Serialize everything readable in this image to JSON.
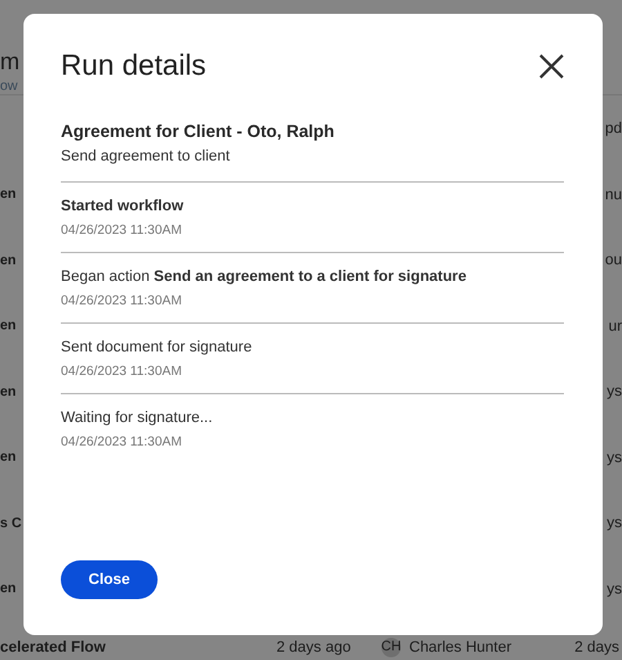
{
  "background": {
    "title": "m",
    "tab": "ow",
    "column_header": "pd",
    "rows": [
      {
        "name": "en",
        "updated": "nu"
      },
      {
        "name": "en",
        "updated": "ou"
      },
      {
        "name": "en",
        "updated": "ur"
      },
      {
        "name": "en",
        "updated": "ys"
      },
      {
        "name": "en",
        "updated": "ys"
      },
      {
        "name": "s C",
        "updated": "ys"
      },
      {
        "name": "en",
        "updated": "ys"
      }
    ],
    "last_row": {
      "name": "celerated Flow",
      "created": "2 days ago",
      "owner_initials": "CH",
      "owner": "Charles Hunter",
      "updated": "2 days"
    }
  },
  "dialog": {
    "title": "Run details",
    "agreement": "Agreement for Client - Oto, Ralph",
    "subtitle": "Send agreement to client",
    "events": [
      {
        "text": "Started workflow",
        "bold": true,
        "time": "04/26/2023 11:30AM"
      },
      {
        "text": "Began action **Send an agreement to a client for signature**",
        "bold": false,
        "time": "04/26/2023 11:30AM"
      },
      {
        "text": "Sent document for signature",
        "bold": false,
        "time": "04/26/2023 11:30AM"
      },
      {
        "text": "Waiting for signature...",
        "bold": false,
        "time": "04/26/2023 11:30AM"
      }
    ],
    "button": "Close"
  }
}
